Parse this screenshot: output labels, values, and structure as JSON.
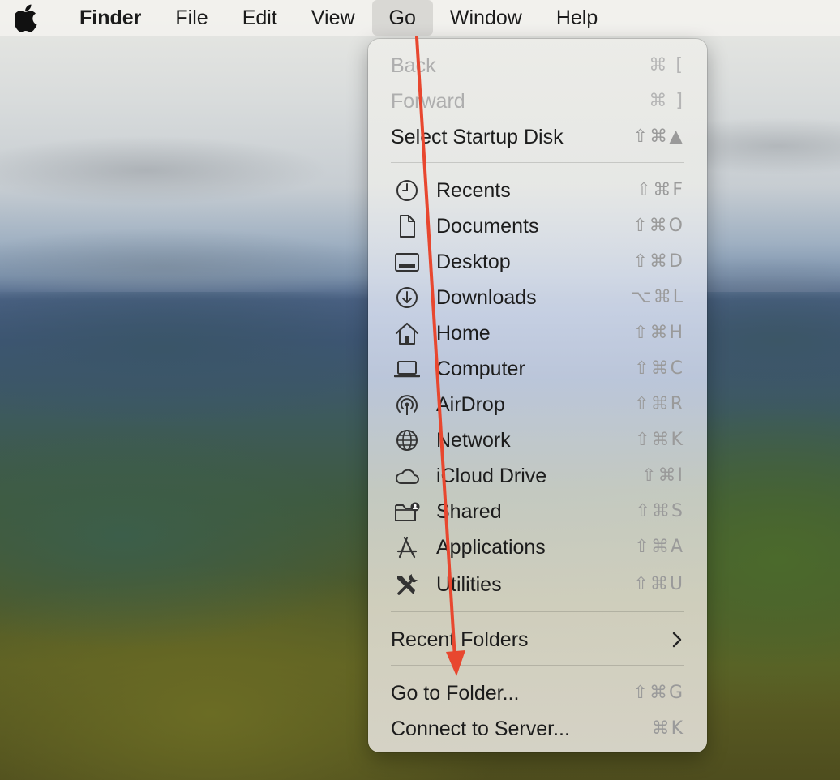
{
  "menubar": {
    "apple_icon": "apple-logo-icon",
    "app_name": "Finder",
    "items": [
      "File",
      "Edit",
      "View",
      "Go",
      "Window",
      "Help"
    ],
    "active_item": "Go"
  },
  "go_menu": {
    "back": {
      "label": "Back",
      "shortcut": "⌘ ["
    },
    "forward": {
      "label": "Forward",
      "shortcut": "⌘ ]"
    },
    "startup_disk": {
      "label": "Select Startup Disk",
      "shortcut": "⇧⌘▲"
    },
    "places": [
      {
        "label": "Recents",
        "shortcut": "⇧⌘F",
        "icon": "clock-icon"
      },
      {
        "label": "Documents",
        "shortcut": "⇧⌘O",
        "icon": "document-icon"
      },
      {
        "label": "Desktop",
        "shortcut": "⇧⌘D",
        "icon": "desktop-icon"
      },
      {
        "label": "Downloads",
        "shortcut": "⌥⌘L",
        "icon": "download-icon"
      },
      {
        "label": "Home",
        "shortcut": "⇧⌘H",
        "icon": "home-icon"
      },
      {
        "label": "Computer",
        "shortcut": "⇧⌘C",
        "icon": "laptop-icon"
      },
      {
        "label": "AirDrop",
        "shortcut": "⇧⌘R",
        "icon": "airdrop-icon"
      },
      {
        "label": "Network",
        "shortcut": "⇧⌘K",
        "icon": "globe-icon"
      },
      {
        "label": "iCloud Drive",
        "shortcut": "⇧⌘I",
        "icon": "cloud-icon"
      },
      {
        "label": "Shared",
        "shortcut": "⇧⌘S",
        "icon": "shared-folder-icon"
      },
      {
        "label": "Applications",
        "shortcut": "⇧⌘A",
        "icon": "applications-icon"
      },
      {
        "label": "Utilities",
        "shortcut": "⇧⌘U",
        "icon": "utilities-icon"
      }
    ],
    "recent_folders": {
      "label": "Recent Folders",
      "icon": "chevron-right-icon"
    },
    "go_to_folder": {
      "label": "Go to Folder...",
      "shortcut": "⇧⌘G"
    },
    "connect_server": {
      "label": "Connect to Server...",
      "shortcut": "⌘K"
    }
  },
  "annotation": {
    "color": "#e8472f"
  }
}
